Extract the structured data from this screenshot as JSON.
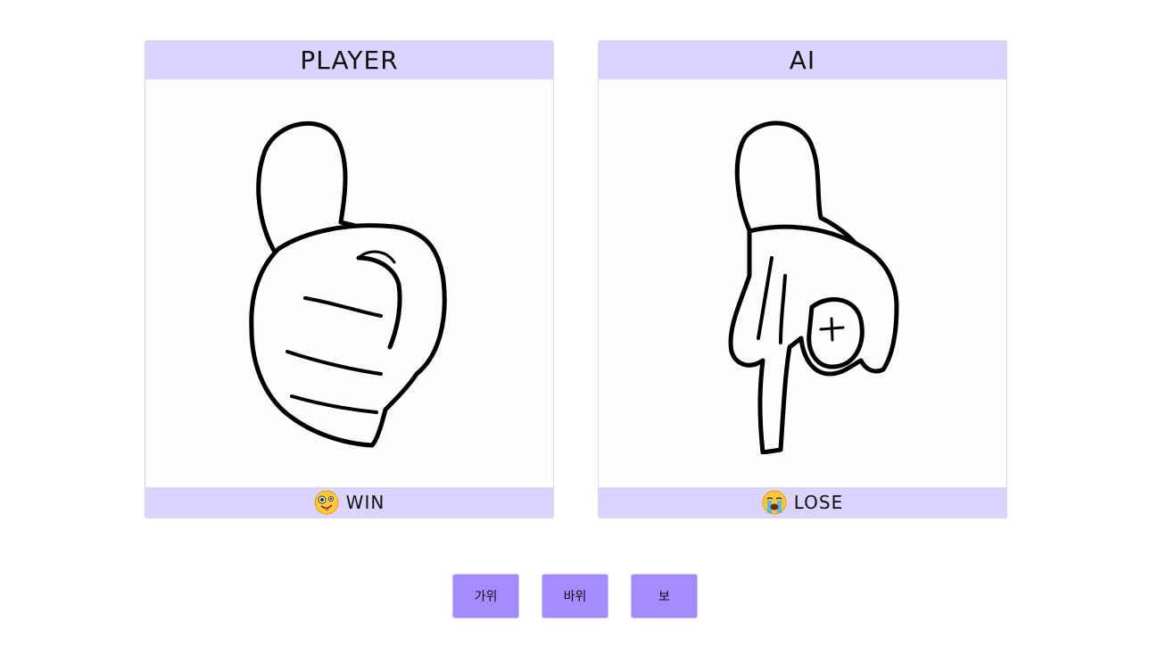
{
  "player": {
    "title": "PLAYER",
    "hand": "rock",
    "result_icon": "zany-face-emoji-icon",
    "result_text": "WIN"
  },
  "ai": {
    "title": "AI",
    "hand": "scissors",
    "result_icon": "loudly-crying-face-emoji-icon",
    "result_text": "LOSE"
  },
  "controls": {
    "scissors_label": "가위",
    "rock_label": "바위",
    "paper_label": "보"
  },
  "colors": {
    "panel_band": "#dcd4ff",
    "button": "#a48bff"
  }
}
